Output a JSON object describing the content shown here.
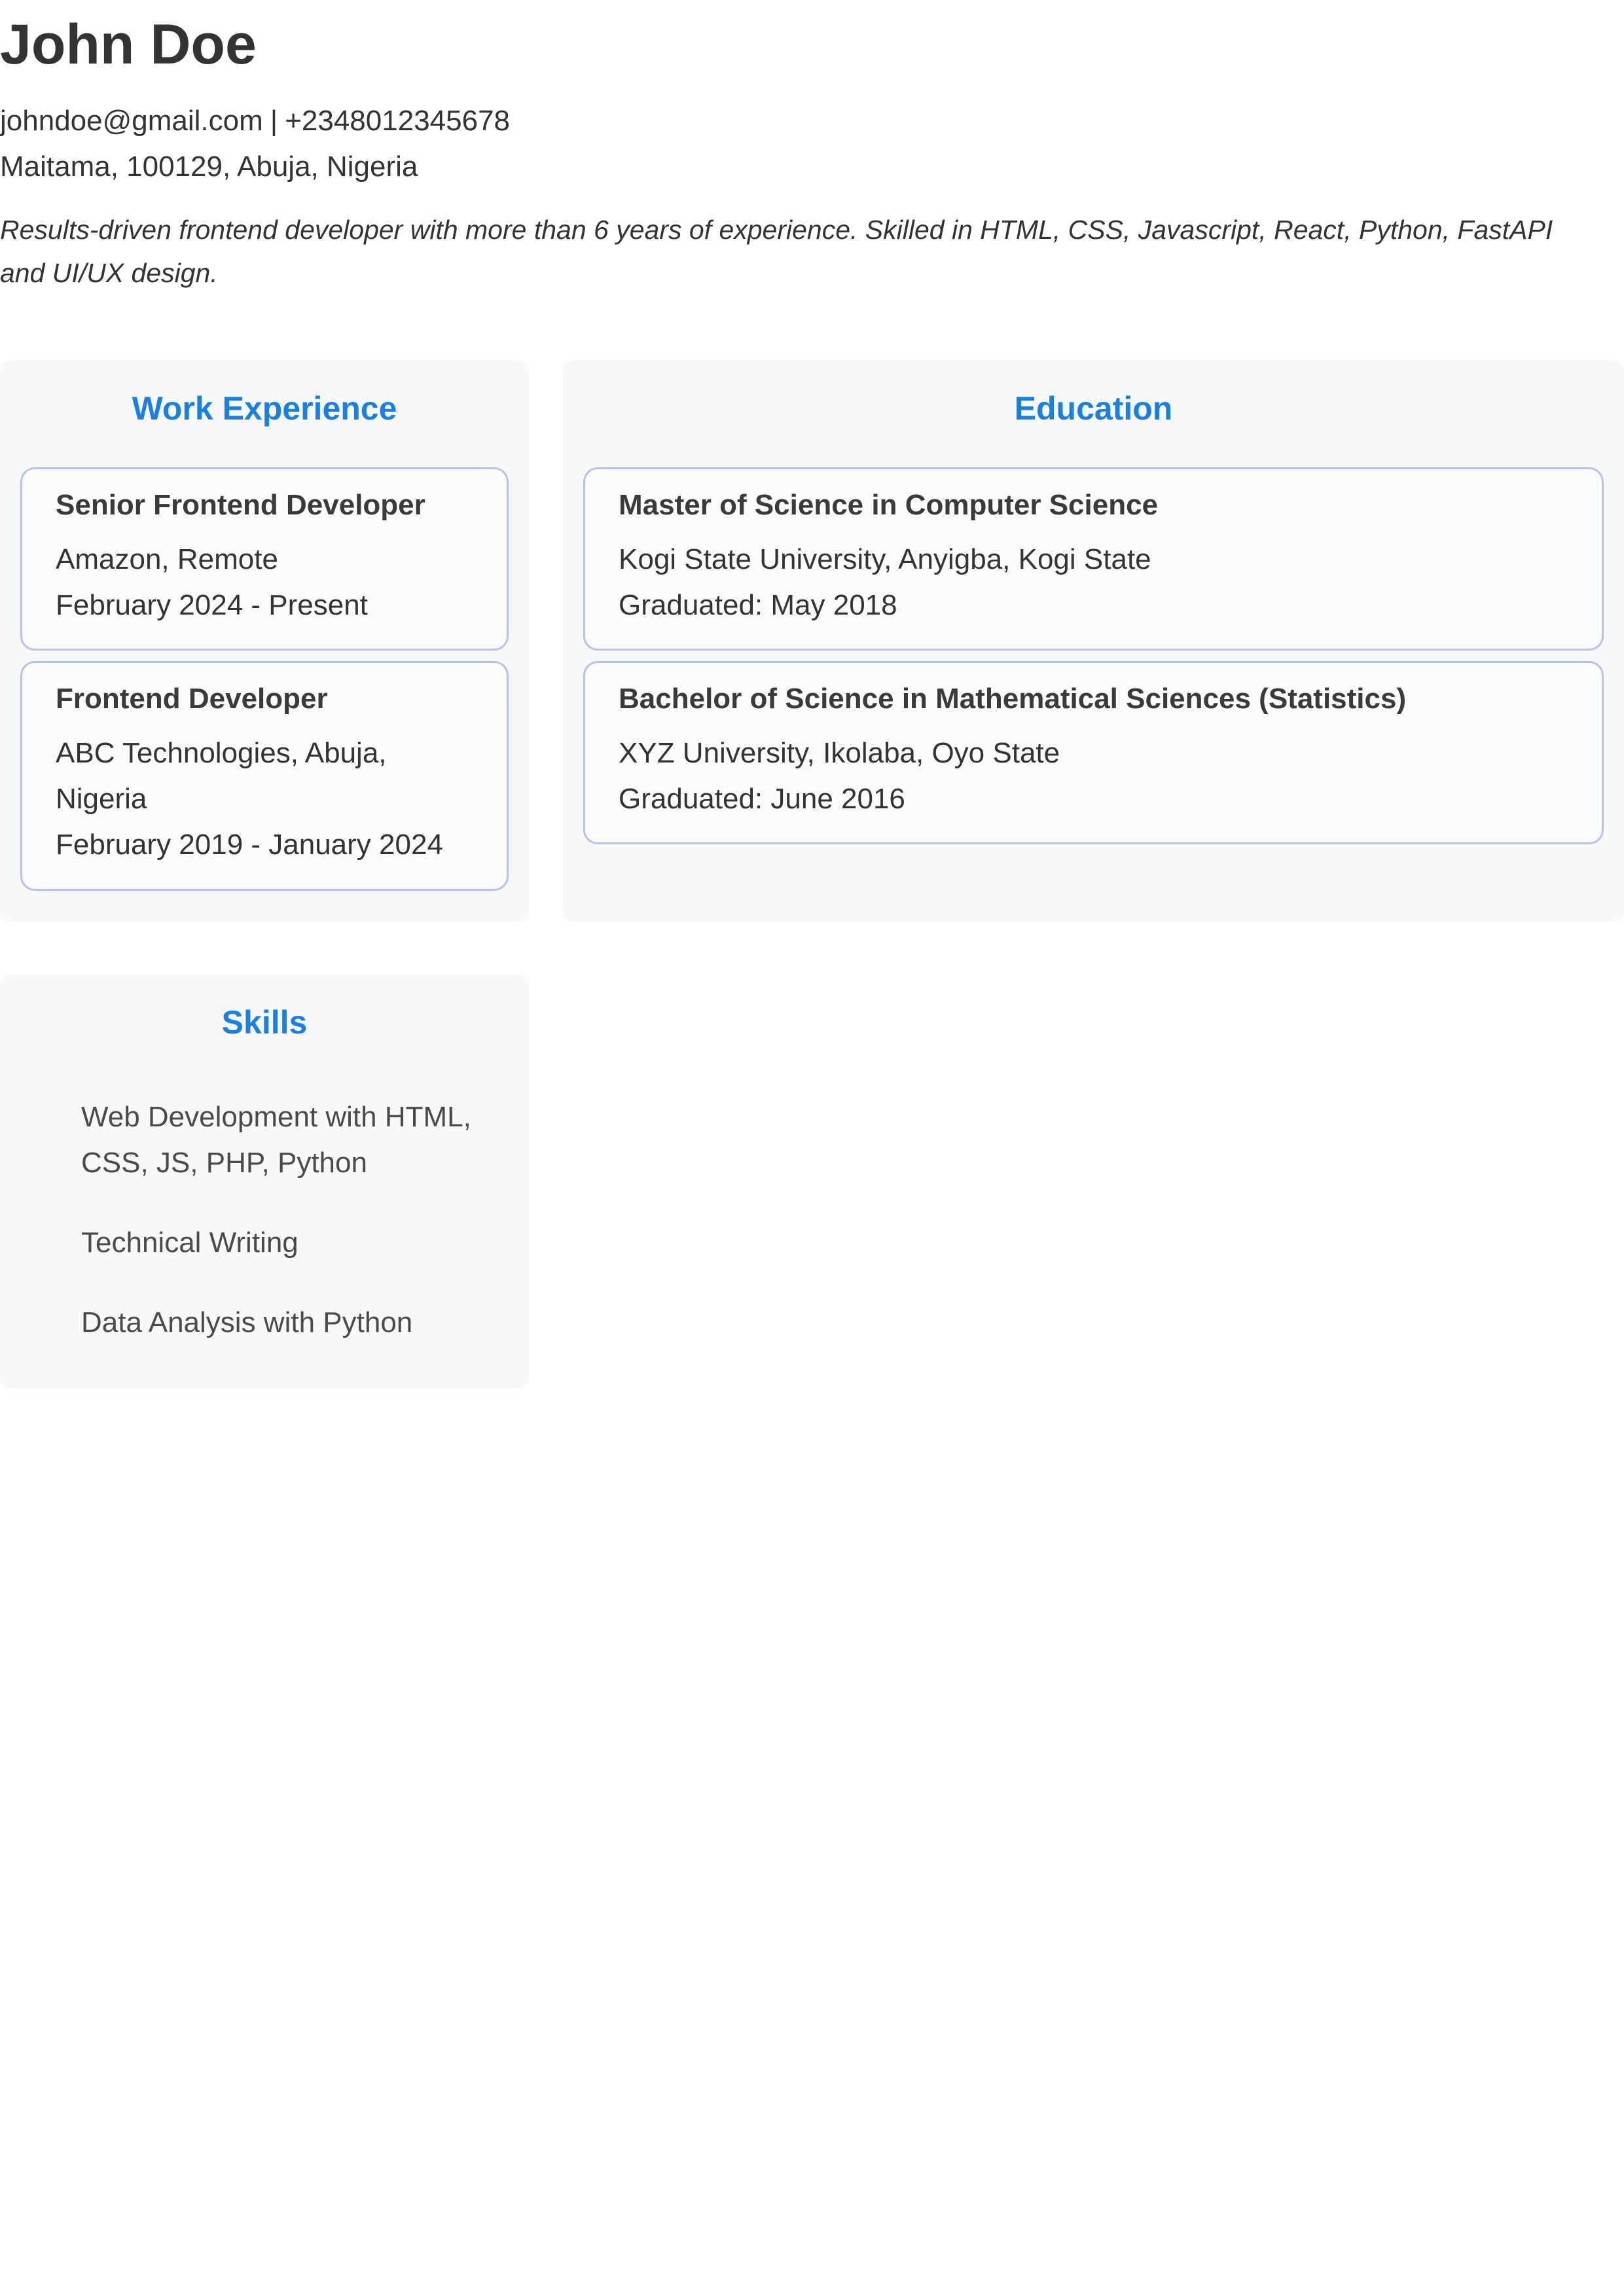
{
  "header": {
    "name": "John Doe",
    "email": "johndoe@gmail.com",
    "separator": "|",
    "phone": "+2348012345678",
    "address": "Maitama, 100129, Abuja, Nigeria",
    "summary": "Results-driven frontend developer with more than 6 years of experience. Skilled in HTML, CSS, Javascript, React, Python, FastAPI and UI/UX design."
  },
  "work": {
    "title": "Work Experience",
    "items": [
      {
        "role": "Senior Frontend Developer",
        "company": "Amazon, Remote",
        "dates": "February 2024 - Present"
      },
      {
        "role": "Frontend Developer",
        "company": "ABC Technologies, Abuja, Nigeria",
        "dates": "February 2019 - January 2024"
      }
    ]
  },
  "education": {
    "title": "Education",
    "items": [
      {
        "degree": "Master of Science in Computer Science",
        "school": "Kogi State University, Anyigba, Kogi State",
        "graduated": "Graduated: May 2018"
      },
      {
        "degree": "Bachelor of Science in Mathematical Sciences (Statistics)",
        "school": "XYZ University, Ikolaba, Oyo State",
        "graduated": "Graduated: June 2016"
      }
    ]
  },
  "skills": {
    "title": "Skills",
    "items": [
      "Web Development with HTML, CSS, JS, PHP, Python",
      "Technical Writing",
      "Data Analysis with Python"
    ]
  },
  "colors": {
    "section_title": "#1a7fe0",
    "section_bg": "#f7f8fa",
    "card_border": "#b8c0ec",
    "text": "#333333"
  }
}
